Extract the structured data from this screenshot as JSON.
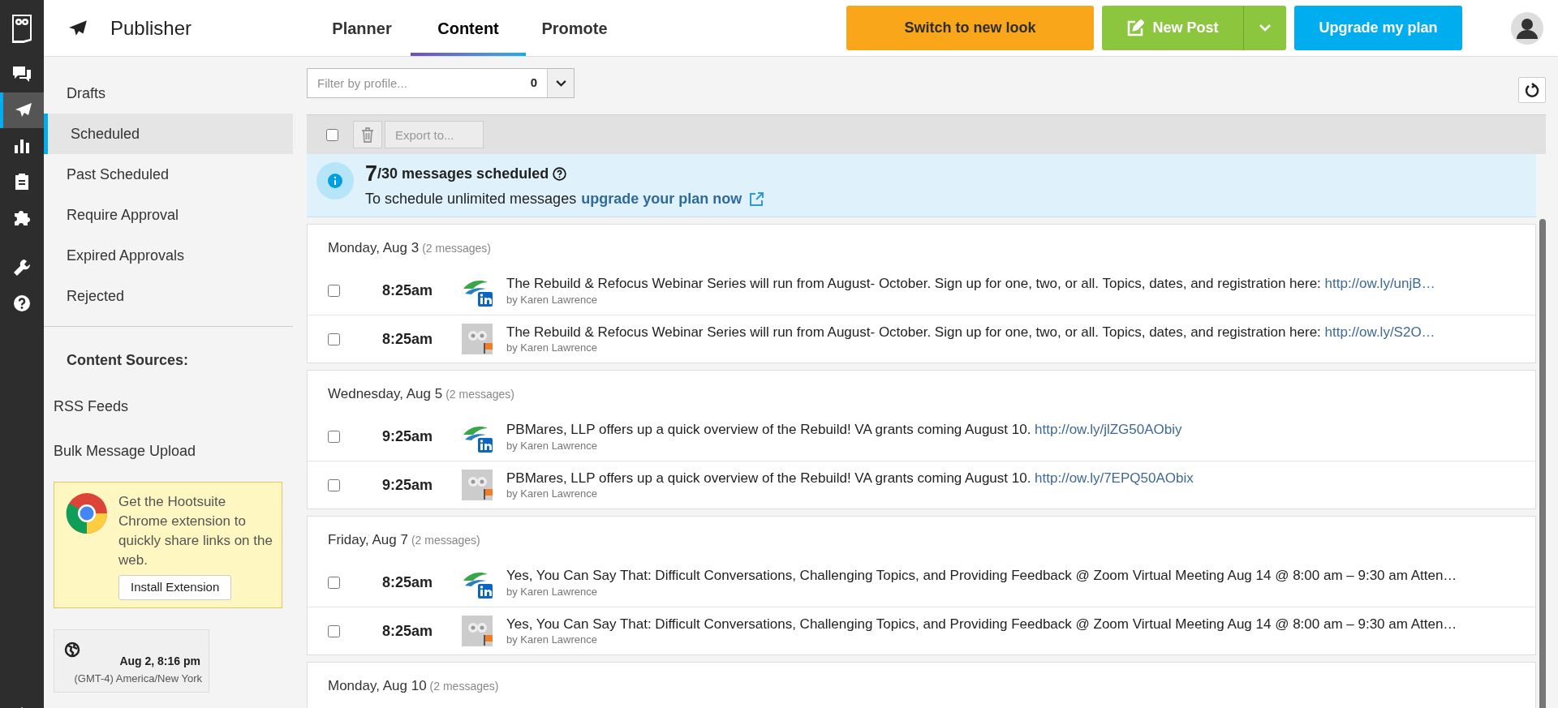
{
  "rail": [
    {
      "kind": "chat",
      "selected": false
    },
    {
      "kind": "send",
      "selected": true
    },
    {
      "kind": "chart",
      "selected": false
    },
    {
      "kind": "clipboard",
      "selected": false
    },
    {
      "kind": "puzzle",
      "selected": false
    },
    {
      "kind": "wrench",
      "selected": false
    },
    {
      "kind": "help",
      "selected": false
    }
  ],
  "header": {
    "title": "Publisher",
    "tabs": [
      {
        "label": "Planner",
        "selected": false
      },
      {
        "label": "Content",
        "selected": true
      },
      {
        "label": "Promote",
        "selected": false
      }
    ],
    "switch_button": "Switch to new look",
    "new_post_button": "New Post",
    "upgrade_button": "Upgrade my plan"
  },
  "sidebar": {
    "items": [
      {
        "label": "Drafts",
        "selected": false
      },
      {
        "label": "Scheduled",
        "selected": true
      },
      {
        "label": "Past Scheduled",
        "selected": false
      },
      {
        "label": "Require Approval",
        "selected": false
      },
      {
        "label": "Expired Approvals",
        "selected": false
      },
      {
        "label": "Rejected",
        "selected": false
      }
    ],
    "sources_heading": "Content Sources:",
    "sources": [
      "RSS Feeds",
      "Bulk Message Upload"
    ],
    "promo": {
      "text": "Get the Hootsuite Chrome extension to quickly share links on the web.",
      "button": "Install Extension"
    },
    "clock": {
      "time": "Aug 2, 8:16 pm",
      "zone": "(GMT-4) America/New York"
    }
  },
  "filter": {
    "placeholder": "Filter by profile...",
    "count": "0"
  },
  "toolbar": {
    "select_all_checked": false,
    "export_placeholder": "Export to..."
  },
  "banner": {
    "count": "7",
    "total": "/30 messages scheduled",
    "text": "To schedule unlimited messages",
    "link": "upgrade your plan now"
  },
  "groups": [
    {
      "date": "Monday, Aug 3",
      "count": "(2 messages)",
      "messages": [
        {
          "checked": false,
          "time": "8:25am",
          "kind": "linkedin",
          "text": "The Rebuild & Refocus Webinar Series will run from August- October. Sign up for one, two, or all. Topics, dates, and registration here:",
          "link": "http://ow.ly/unjB…",
          "author": "by Karen Lawrence"
        },
        {
          "checked": false,
          "time": "8:25am",
          "kind": "owl",
          "text": "The Rebuild & Refocus Webinar Series will run from August- October. Sign up for one, two, or all. Topics, dates, and registration here:",
          "link": "http://ow.ly/S2O…",
          "author": "by Karen Lawrence"
        }
      ]
    },
    {
      "date": "Wednesday, Aug 5",
      "count": "(2 messages)",
      "messages": [
        {
          "checked": false,
          "time": "9:25am",
          "kind": "linkedin",
          "text": "PBMares, LLP offers up a quick overview of the Rebuild! VA grants coming August 10.",
          "link": "http://ow.ly/jlZG50AObiy",
          "author": "by Karen Lawrence"
        },
        {
          "checked": false,
          "time": "9:25am",
          "kind": "owl",
          "text": "PBMares, LLP offers up a quick overview of the Rebuild! VA grants coming August 10.",
          "link": "http://ow.ly/7EPQ50AObix",
          "author": "by Karen Lawrence"
        }
      ]
    },
    {
      "date": "Friday, Aug 7",
      "count": "(2 messages)",
      "messages": [
        {
          "checked": false,
          "time": "8:25am",
          "kind": "linkedin",
          "text": "Yes, You Can Say That: Difficult Conversations, Challenging Topics, and Providing Feedback @ Zoom Virtual Meeting Aug 14 @ 8:00 am – 9:30 am Atten…",
          "author": "by Karen Lawrence"
        },
        {
          "checked": false,
          "time": "8:25am",
          "kind": "owl",
          "text": "Yes, You Can Say That: Difficult Conversations, Challenging Topics, and Providing Feedback @ Zoom Virtual Meeting Aug 14 @ 8:00 am – 9:30 am Atten…",
          "author": "by Karen Lawrence"
        }
      ]
    },
    {
      "date": "Monday, Aug 10",
      "count": "(2 messages)"
    }
  ]
}
